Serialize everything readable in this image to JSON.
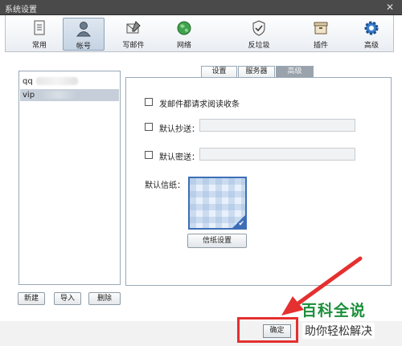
{
  "window": {
    "title": "系统设置",
    "close_glyph": "✕"
  },
  "toolbar": {
    "items": [
      {
        "label": "常用",
        "icon": "document-icon"
      },
      {
        "label": "帐号",
        "icon": "user-icon"
      },
      {
        "label": "写邮件",
        "icon": "compose-icon"
      },
      {
        "label": "网络",
        "icon": "globe-icon"
      },
      {
        "label": "反垃圾",
        "icon": "shield-icon"
      },
      {
        "label": "插件",
        "icon": "plugin-box-icon"
      },
      {
        "label": "高级",
        "icon": "gear-icon"
      }
    ],
    "active_index": 1
  },
  "accounts": {
    "items": [
      {
        "prefix": "qq"
      },
      {
        "prefix": "vip"
      }
    ],
    "selected_index": 1
  },
  "account_buttons": {
    "new": "新建",
    "import": "导入",
    "delete": "删除"
  },
  "tabs": {
    "items": [
      "设置",
      "服务器",
      "高级"
    ],
    "active_index": 2
  },
  "advanced": {
    "read_receipt": {
      "label": "发邮件都请求阅读收条",
      "checked": false
    },
    "default_cc": {
      "label": "默认抄送：",
      "checked": false,
      "value": ""
    },
    "default_bcc": {
      "label": "默认密送：",
      "checked": false,
      "value": ""
    },
    "stationery_label": "默认信纸：",
    "stationery_button": "信纸设置"
  },
  "footer": {
    "ok": "确定"
  },
  "watermark": {
    "line1": "百科全说",
    "line2": "助你轻松解决"
  },
  "colors": {
    "highlight_red": "#e53030",
    "accent_blue": "#3d6fb6",
    "watermark_green": "#1a8f3a"
  }
}
